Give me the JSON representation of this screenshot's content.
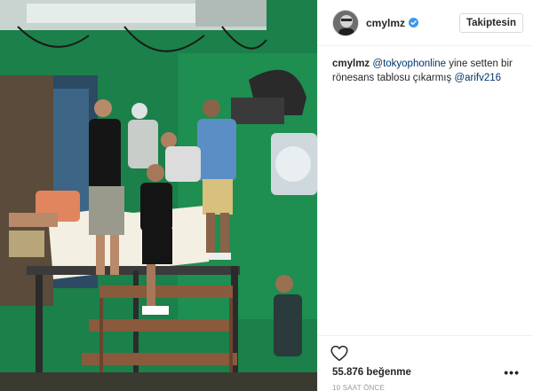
{
  "post": {
    "photo_alt": "",
    "header": {
      "username": "cmylmz",
      "verified": true,
      "follow_label": "Takiptesin"
    },
    "caption": {
      "username": "cmylmz",
      "mention1": "@tokyophonline",
      "text_middle": " yine setten bir rönesans tablosu çıkarmış ",
      "mention2": "@arifv216"
    },
    "likes": "55.876 beğenme",
    "time": "10 SAAT ÖNCE",
    "more": "•••"
  },
  "colors": {
    "link": "#003569",
    "text": "#262626",
    "muted": "#999999",
    "verified": "#3897f0",
    "green_screen": "#1d8a4e"
  },
  "icons": {
    "verified": "verified-badge-icon",
    "like": "heart-outline-icon",
    "more": "more-options-icon"
  }
}
